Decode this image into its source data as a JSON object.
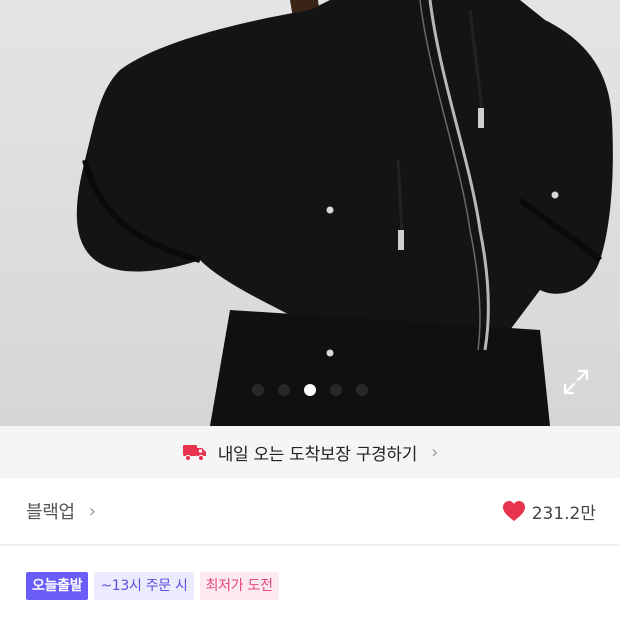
{
  "product_image": {
    "carousel": {
      "count": 5,
      "active_index": 2
    }
  },
  "delivery_banner": {
    "text": "내일 오는 도착보장 구경하기",
    "chevron": "›"
  },
  "brand": {
    "name": "블랙업",
    "chevron": "›"
  },
  "like": {
    "count": "231.2만",
    "color": "#e8344e"
  },
  "badges": [
    {
      "label": "오늘출발"
    },
    {
      "label": "~13시 주문 시"
    },
    {
      "label": "최저가 도전"
    }
  ],
  "colors": {
    "accent_purple": "#6a5cf6",
    "accent_pink": "#e8487e",
    "heart_red": "#e8344e"
  }
}
